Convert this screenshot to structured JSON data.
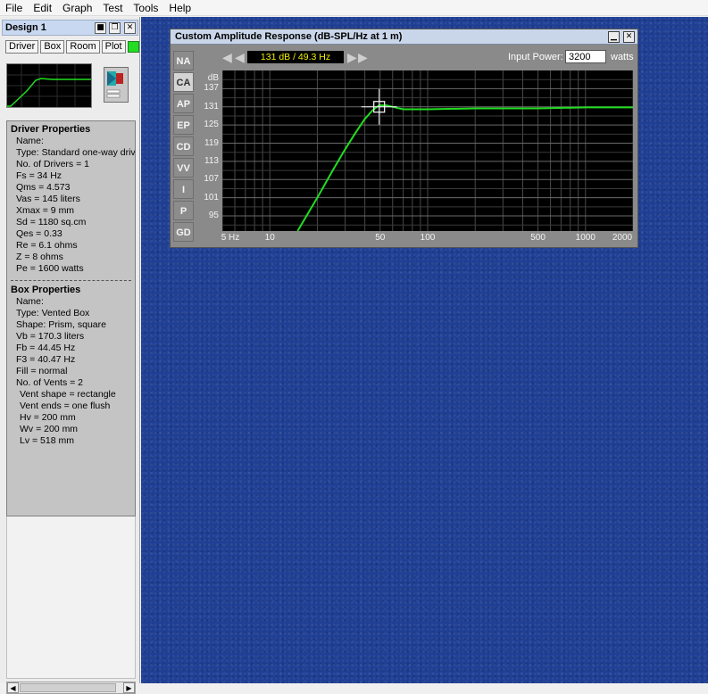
{
  "menu": [
    "File",
    "Edit",
    "Graph",
    "Test",
    "Tools",
    "Help"
  ],
  "design": {
    "title": "Design 1",
    "buttons": [
      "■",
      "❐",
      "✕"
    ],
    "tabs": [
      "Driver",
      "Box",
      "Room",
      "Plot"
    ]
  },
  "driver": {
    "title": "Driver Properties",
    "lines": [
      "Name:",
      "Type: Standard one-way driver",
      "No. of Drivers = 1",
      "Fs =  34 Hz",
      "Qms =  4.573",
      "Vas =  145 liters",
      "Xmax =  9 mm",
      "Sd =  1180 sq.cm",
      "Qes =  0.33",
      "Re =  6.1 ohms",
      "Z =  8 ohms",
      "Pe =  1600 watts"
    ]
  },
  "box": {
    "title": "Box Properties",
    "lines": [
      "Name:",
      "Type: Vented Box",
      "Shape: Prism, square",
      "Vb =  170.3 liters",
      "Fb =  44.45 Hz",
      "F3 =  40.47 Hz",
      "Fill = normal",
      "No. of Vents = 2"
    ],
    "vent_lines": [
      "Vent shape = rectangle",
      "Vent ends = one flush",
      "Hv =  200 mm",
      "Wv =  200 mm",
      "Lv =  518 mm"
    ]
  },
  "scroll": {
    "left": "◀",
    "right": "▶"
  },
  "chart_window": {
    "title": "Custom Amplitude Response (dB-SPL/Hz at 1 m)",
    "buttons": [
      "▁",
      "✕"
    ],
    "side_tabs": [
      "NA",
      "CA",
      "AP",
      "EP",
      "CD",
      "VV",
      "I",
      "P",
      "GD"
    ],
    "active_tab": "CA",
    "readout": "131 dB / 49.3 Hz",
    "input_power_label": "Input Power:",
    "input_power_value": "3200",
    "input_power_unit": "watts",
    "nav": [
      "◀",
      "◀",
      "▶",
      "▶"
    ]
  },
  "chart_data": {
    "type": "line",
    "ylabel": "dB",
    "x_scale": "log",
    "xlim": [
      5,
      2000
    ],
    "ylim": [
      90,
      143
    ],
    "x_ticks": [
      5,
      10,
      50,
      100,
      500,
      1000,
      2000
    ],
    "x_tick_labels": [
      "5 Hz",
      "10",
      "50",
      "100",
      "500",
      "1000",
      "2000"
    ],
    "y_ticks": [
      95,
      101,
      107,
      113,
      119,
      125,
      131,
      137
    ],
    "grid": true,
    "series": [
      {
        "color": "#22dd22",
        "x": [
          15,
          20,
          25,
          30,
          35,
          40,
          45,
          49.3,
          55,
          60,
          70,
          100,
          200,
          500,
          1000,
          2000
        ],
        "y": [
          90,
          101,
          110,
          117,
          122.5,
          127,
          130,
          131.5,
          131.5,
          131,
          130.2,
          130.2,
          130.5,
          130.5,
          130.8,
          130.8
        ]
      }
    ],
    "cursor": {
      "x": 49.3,
      "y": 131
    }
  }
}
